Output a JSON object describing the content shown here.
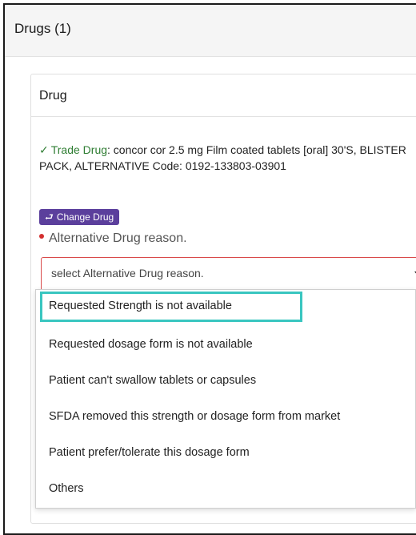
{
  "panel": {
    "title": "Drugs (1)"
  },
  "card": {
    "title": "Drug"
  },
  "trade_drug": {
    "check": "✓",
    "label": "Trade Drug",
    "description": ": concor cor 2.5 mg Film coated tablets [oral] 30'S, BLISTER PACK, ALTERNATIVE Code: 0192-133803-03901"
  },
  "change_drug": {
    "icon": "⮐",
    "label": "Change Drug"
  },
  "alt_reason": {
    "label": "Alternative Drug reason.",
    "placeholder": "select Alternative Drug reason.",
    "options": [
      "Requested Strength is not available",
      "Requested dosage form is not available",
      "Patient can't swallow tablets or capsules",
      "SFDA removed this strength or dosage form from market",
      "Patient prefer/tolerate this dosage form",
      "Others"
    ],
    "highlighted_index": 0
  },
  "colors": {
    "trade_green": "#2e7d32",
    "button_purple": "#5b3f9c",
    "required_red": "#d32f2f",
    "highlight_teal": "#39c6c0"
  }
}
